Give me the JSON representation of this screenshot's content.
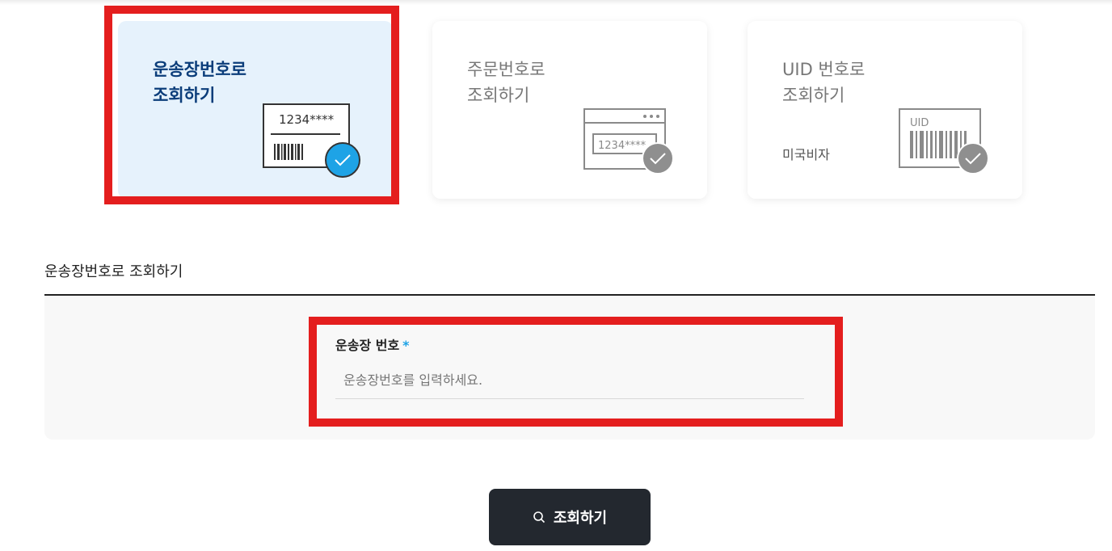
{
  "cards": [
    {
      "title_line1": "운송장번호로",
      "title_line2": "조회하기",
      "illustration_text": "1234****",
      "selected": true
    },
    {
      "title_line1": "주문번호로",
      "title_line2": "조회하기",
      "illustration_text": "1234****",
      "selected": false
    },
    {
      "title_line1": "UID 번호로",
      "title_line2": "조회하기",
      "note": "미국비자",
      "illustration_text": "UID",
      "selected": false
    }
  ],
  "section": {
    "title": "운송장번호로 조회하기"
  },
  "form": {
    "label": "운송장 번호",
    "required_mark": "*",
    "placeholder": "운송장번호를 입력하세요.",
    "value": ""
  },
  "submit": {
    "label": "조회하기",
    "icon": "search-icon"
  },
  "colors": {
    "accent": "#1ea3e6",
    "selected_title": "#0b3d7a",
    "selected_card_bg": "#e6f2fc",
    "button_bg": "#23282f",
    "highlight": "#e41e1e"
  }
}
